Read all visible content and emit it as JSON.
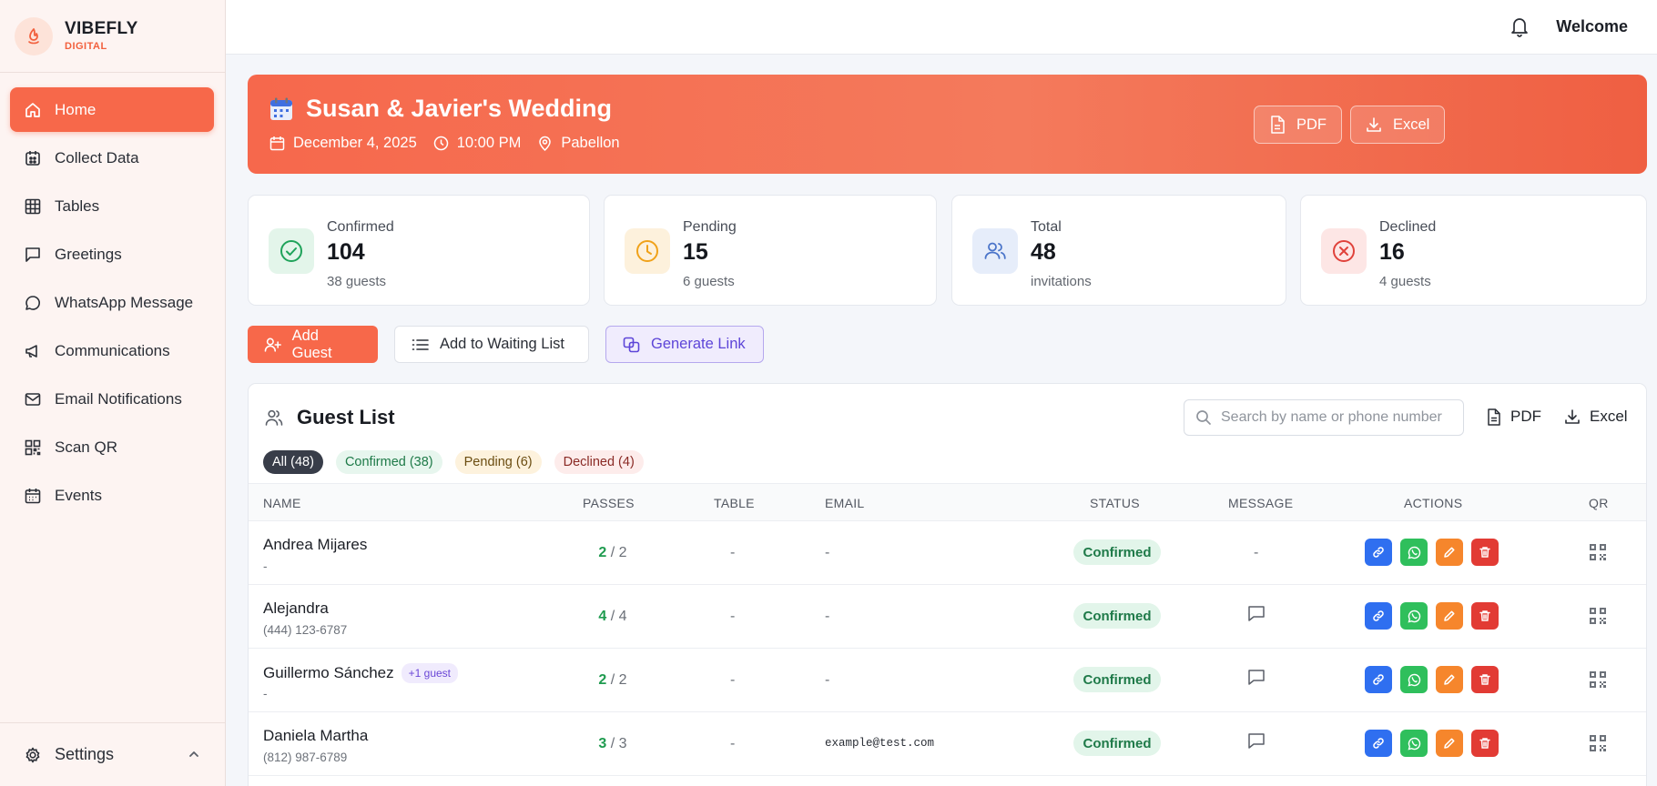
{
  "brand": {
    "name": "VIBEFLY",
    "sub": "DIGITAL"
  },
  "sidebar": {
    "items": [
      {
        "label": "Home",
        "icon": "home-icon",
        "active": true
      },
      {
        "label": "Collect Data",
        "icon": "collect-data-icon"
      },
      {
        "label": "Tables",
        "icon": "tables-grid-icon"
      },
      {
        "label": "Greetings",
        "icon": "greetings-chat-icon"
      },
      {
        "label": "WhatsApp Message",
        "icon": "whatsapp-message-icon"
      },
      {
        "label": "Communications",
        "icon": "megaphone-icon"
      },
      {
        "label": "Email Notifications",
        "icon": "mail-icon"
      },
      {
        "label": "Scan QR",
        "icon": "qr-code-icon"
      },
      {
        "label": "Events",
        "icon": "calendar-icon"
      }
    ],
    "settings_label": "Settings"
  },
  "topbar": {
    "welcome": "Welcome"
  },
  "event": {
    "title": "Susan & Javier's Wedding",
    "date": "December 4, 2025",
    "time": "10:00 PM",
    "venue": "Pabellon",
    "pdf_label": "PDF",
    "excel_label": "Excel"
  },
  "stats": [
    {
      "label": "Confirmed",
      "value": "104",
      "sub": "38 guests",
      "color": "#1fa35a"
    },
    {
      "label": "Pending",
      "value": "15",
      "sub": "6 guests",
      "color": "#f0a21a"
    },
    {
      "label": "Total",
      "value": "48",
      "sub": "invitations",
      "color": "#4a74c9"
    },
    {
      "label": "Declined",
      "value": "16",
      "sub": "4 guests",
      "color": "#e0423b"
    }
  ],
  "actions": {
    "add_guest": "Add Guest",
    "waiting_list": "Add to Waiting List",
    "generate_link": "Generate Link"
  },
  "guest_list": {
    "title": "Guest List",
    "search_placeholder": "Search by name or phone number",
    "pdf_label": "PDF",
    "excel_label": "Excel",
    "filters": [
      "All (48)",
      "Confirmed (38)",
      "Pending (6)",
      "Declined (4)"
    ],
    "columns": [
      "NAME",
      "PASSES",
      "TABLE",
      "EMAIL",
      "STATUS",
      "MESSAGE",
      "ACTIONS",
      "QR"
    ],
    "rows": [
      {
        "name": "Andrea Mijares",
        "tag": "",
        "phone": "-",
        "passes_used": "2",
        "passes_total": "/ 2",
        "table": "-",
        "email": "-",
        "status": "Confirmed",
        "message": "-"
      },
      {
        "name": "Alejandra",
        "tag": "",
        "phone": "(444) 123-6787",
        "passes_used": "4",
        "passes_total": "/ 4",
        "table": "-",
        "email": "-",
        "status": "Confirmed",
        "message": ""
      },
      {
        "name": "Guillermo Sánchez",
        "tag": "+1 guest",
        "phone": "-",
        "passes_used": "2",
        "passes_total": "/ 2",
        "table": "-",
        "email": "-",
        "status": "Confirmed",
        "message": ""
      },
      {
        "name": "Daniela Martha",
        "tag": "",
        "phone": "(812) 987-6789",
        "passes_used": "3",
        "passes_total": "/ 3",
        "table": "-",
        "email": "example@test.com",
        "status": "Confirmed",
        "message": ""
      }
    ]
  }
}
